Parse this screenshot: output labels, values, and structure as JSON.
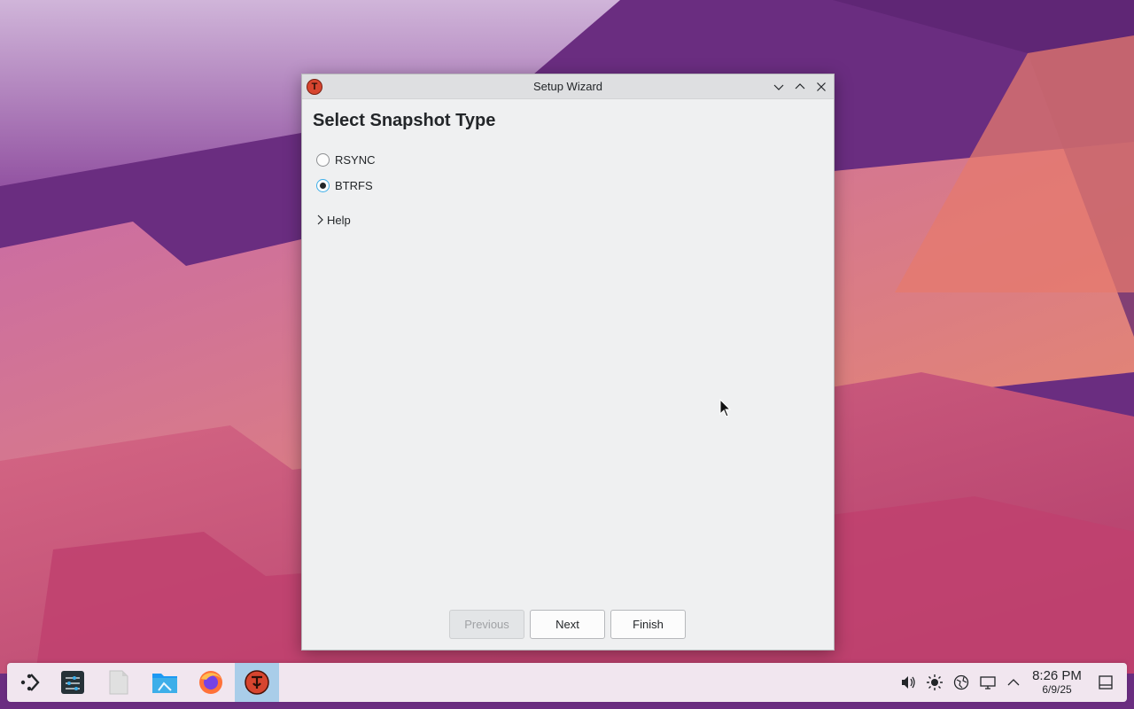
{
  "window": {
    "title": "Setup Wizard",
    "app_icon_glyph": "T",
    "heading": "Select Snapshot Type",
    "options": [
      {
        "label": "RSYNC",
        "checked": false
      },
      {
        "label": "BTRFS",
        "checked": true
      }
    ],
    "help_label": "Help",
    "buttons": {
      "previous": "Previous",
      "next": "Next",
      "finish": "Finish"
    },
    "titlebar_icons": [
      "minimize-icon",
      "maximize-icon",
      "close-icon"
    ]
  },
  "taskbar": {
    "items": [
      "application-launcher-icon",
      "system-settings-icon",
      "text-document-icon",
      "file-manager-icon",
      "firefox-icon",
      "timeshift-icon"
    ],
    "active_item": "timeshift-icon",
    "tray_icons": [
      "volume-icon",
      "brightness-icon",
      "network-icon",
      "display-icon",
      "tray-expand-icon",
      "show-desktop-icon"
    ],
    "clock": {
      "time": "8:26 PM",
      "date": "6/9/25"
    }
  },
  "colors": {
    "accent": "#3daee9",
    "active_task": "#a9cde9",
    "app_icon": "#d7452f"
  }
}
